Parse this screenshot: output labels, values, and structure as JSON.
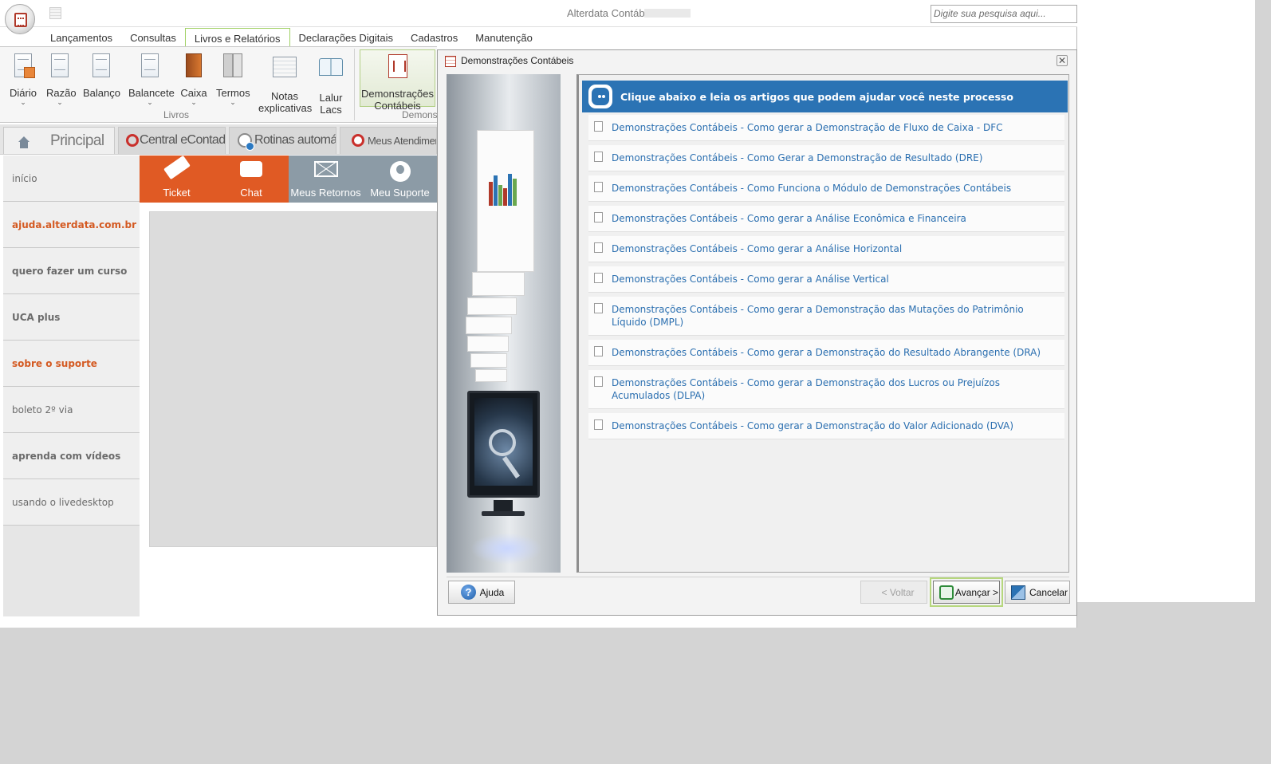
{
  "window": {
    "title": "Alterdata Contábil",
    "search_placeholder": "Digite sua pesquisa aqui..."
  },
  "ribbon_tabs": [
    "Lançamentos",
    "Consultas",
    "Livros e Relatórios",
    "Declarações Digitais",
    "Cadastros",
    "Manutenção"
  ],
  "ribbon": {
    "buttons": {
      "diario": "Diário",
      "razao": "Razão",
      "balanco": "Balanço",
      "balancete": "Balancete",
      "caixa": "Caixa",
      "termos": "Termos",
      "notas_1": "Notas",
      "notas_2": "explicativas",
      "lalur_1": "Lalur",
      "lalur_2": "Lacs",
      "dem_1": "Demonstrações",
      "dem_2": "Contábeis"
    },
    "group_livros": "Livros",
    "group_demons": "Demons"
  },
  "main_tabs": {
    "principal": "Principal",
    "econtador": "Central eContador",
    "rotinas": "Rotinas automáticas",
    "atendimento": "Meus Atendimento"
  },
  "sidebar": [
    "início",
    "ajuda.alterdata.com.br",
    "quero fazer um curso",
    "UCA plus",
    "sobre o suporte",
    "boleto 2º via",
    "aprenda com vídeos",
    "usando o livedesktop"
  ],
  "tiles": {
    "ticket": "Ticket",
    "chat": "Chat",
    "retornos": "Meus Retornos",
    "suporte": "Meu Suporte"
  },
  "dialog": {
    "title": "Demonstrações Contábeis",
    "banner": "Clique abaixo e leia os artigos que podem ajudar você neste processo",
    "articles": [
      "Demonstrações Contábeis - Como gerar a Demonstração de Fluxo de Caixa - DFC",
      "Demonstrações Contábeis - Como Gerar a Demonstração de Resultado (DRE)",
      "Demonstrações Contábeis - Como Funciona o Módulo de Demonstrações Contábeis",
      "Demonstrações Contábeis - Como gerar a Análise Econômica e Financeira",
      "Demonstrações Contábeis - Como gerar a Análise Horizontal",
      "Demonstrações Contábeis - Como gerar a Análise Vertical",
      "Demonstrações Contábeis - Como gerar a Demonstração das Mutações do Patrimônio Líquido (DMPL)",
      "Demonstrações Contábeis - Como gerar a Demonstração do Resultado Abrangente (DRA)",
      "Demonstrações Contábeis - Como gerar a Demonstração dos Lucros ou Prejuízos Acumulados (DLPA)",
      "Demonstrações Contábeis - Como gerar a Demonstração do Valor Adicionado (DVA)"
    ],
    "buttons": {
      "ajuda": "Ajuda",
      "voltar": "< Voltar",
      "avancar": "Avançar >",
      "cancelar": "Cancelar"
    }
  },
  "colors": {
    "accent_blue": "#2b73b4",
    "tile_orange": "#e05a24",
    "tile_gray": "#8c9ba6",
    "link_blue": "#2b6fb0",
    "highlight_green": "#9fd063"
  }
}
